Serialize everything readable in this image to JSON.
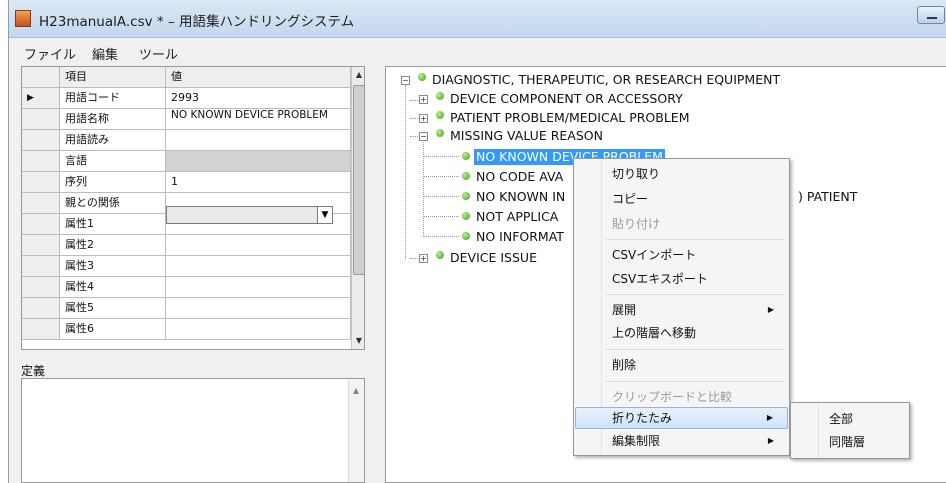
{
  "window": {
    "title": "H23manualA.csv *  –  用語集ハンドリングシステム"
  },
  "menu": [
    "ファイル",
    "編集",
    "ツール"
  ],
  "grid": {
    "headers": [
      "項目",
      "値"
    ],
    "row_marker": "▶",
    "rows": [
      {
        "label": "用語コード",
        "value": "2993"
      },
      {
        "label": "用語名称",
        "value": "NO KNOWN DEVICE PROBLEM"
      },
      {
        "label": "用語読み",
        "value": ""
      },
      {
        "label": "言語",
        "value": ""
      },
      {
        "label": "序列",
        "value": "1"
      },
      {
        "label": "親との関係",
        "value": ""
      },
      {
        "label": "属性1",
        "value": ""
      },
      {
        "label": "属性2",
        "value": ""
      },
      {
        "label": "属性3",
        "value": ""
      },
      {
        "label": "属性4",
        "value": ""
      },
      {
        "label": "属性5",
        "value": ""
      },
      {
        "label": "属性6",
        "value": ""
      }
    ]
  },
  "definition": {
    "label": "定義",
    "text": ""
  },
  "tree": {
    "root": "DIAGNOSTIC, THERAPEUTIC, OR RESEARCH EQUIPMENT",
    "children": [
      "DEVICE COMPONENT OR ACCESSORY",
      "PATIENT PROBLEM/MEDICAL PROBLEM",
      "MISSING VALUE REASON",
      "DEVICE ISSUE"
    ],
    "grandchildren": [
      "NO KNOWN DEVICE PROBLEM",
      "NO CODE AVA",
      "NO KNOWN IN",
      "NOT APPLICA",
      "NO INFORMAT"
    ],
    "overflow_text": ") PATIENT"
  },
  "context_menu": {
    "cut": "切り取り",
    "copy": "コピー",
    "paste": "貼り付け",
    "csv_import": "CSVインポート",
    "csv_export": "CSVエキスポート",
    "expand": "展開",
    "move_up": "上の階層へ移動",
    "delete": "削除",
    "clipboard_compare": "クリップボードと比較",
    "collapse": "折りたたみ",
    "edit_limit": "編集制限"
  },
  "submenu": {
    "all": "全部",
    "same_level": "同階層"
  },
  "colors": {
    "selection": "#3399ff",
    "node_bulb": "#3f9f20",
    "menu_highlight": "#cfe3f7"
  }
}
